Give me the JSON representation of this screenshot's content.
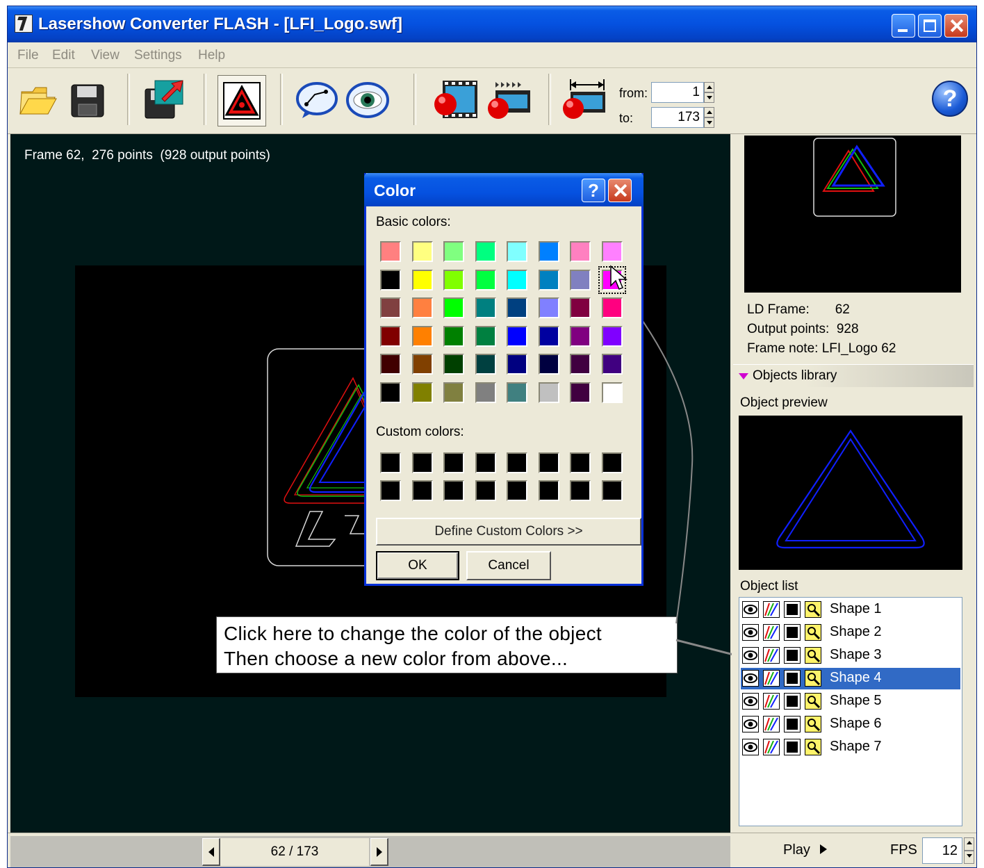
{
  "window": {
    "title": "Lasershow Converter FLASH - [LFI_Logo.swf]"
  },
  "menu": [
    "File",
    "Edit",
    "View",
    "Settings",
    "Help"
  ],
  "toolbar": {
    "icons": [
      "open-folder-icon",
      "save-disk-icon",
      "export-icon",
      "laser-warning-icon",
      "path-tool-icon",
      "eye-preview-icon",
      "convert-frame-icon",
      "convert-all-icon",
      "convert-range-icon"
    ],
    "from_label": "from:",
    "from_value": "1",
    "to_label": "to:",
    "to_value": "173",
    "help_glyph": "?"
  },
  "canvas": {
    "frame_info": "Frame 62,  276 points  (928 output points)"
  },
  "color_dialog": {
    "title": "Color",
    "help_glyph": "?",
    "basic_label": "Basic colors:",
    "basic_colors": [
      "#ff8080",
      "#ffff80",
      "#80ff80",
      "#00ff80",
      "#80ffff",
      "#0080ff",
      "#ff80c0",
      "#ff80ff",
      "#000000",
      "#ffff00",
      "#80ff00",
      "#00ff40",
      "#00ffff",
      "#0080c0",
      "#8080c0",
      "#ff00ff",
      "#804040",
      "#ff8040",
      "#00ff00",
      "#008080",
      "#004080",
      "#8080ff",
      "#800040",
      "#ff0080",
      "#800000",
      "#ff8000",
      "#008000",
      "#008040",
      "#0000ff",
      "#0000a0",
      "#800080",
      "#8000ff",
      "#400000",
      "#804000",
      "#004000",
      "#004040",
      "#000080",
      "#000040",
      "#400040",
      "#400080",
      "#000000",
      "#808000",
      "#808040",
      "#808080",
      "#408080",
      "#c0c0c0",
      "#400040",
      "#ffffff"
    ],
    "selected_index": 15,
    "custom_label": "Custom colors:",
    "custom_colors": [
      "#000000",
      "#000000",
      "#000000",
      "#000000",
      "#000000",
      "#000000",
      "#000000",
      "#000000",
      "#000000",
      "#000000",
      "#000000",
      "#000000",
      "#000000",
      "#000000",
      "#000000",
      "#000000"
    ],
    "define_label": "Define Custom Colors >>",
    "ok_label": "OK",
    "cancel_label": "Cancel"
  },
  "callout": {
    "line1": "Click here to change the color of the object",
    "line2": "Then choose a new color from above..."
  },
  "side": {
    "ld_frame": "LD Frame:       62",
    "output_points": "Output points:  928",
    "frame_note": "Frame note: LFI_Logo 62",
    "objects_library": "Objects library",
    "object_preview": "Object preview",
    "object_list": "Object list",
    "objects": [
      "Shape 1",
      "Shape 2",
      "Shape 3",
      "Shape 4",
      "Shape 5",
      "Shape 6",
      "Shape 7"
    ],
    "selected_object": 3
  },
  "status": {
    "frame_counter": "62 / 173",
    "play_label": "Play",
    "fps_label": "FPS",
    "fps_value": "12"
  }
}
